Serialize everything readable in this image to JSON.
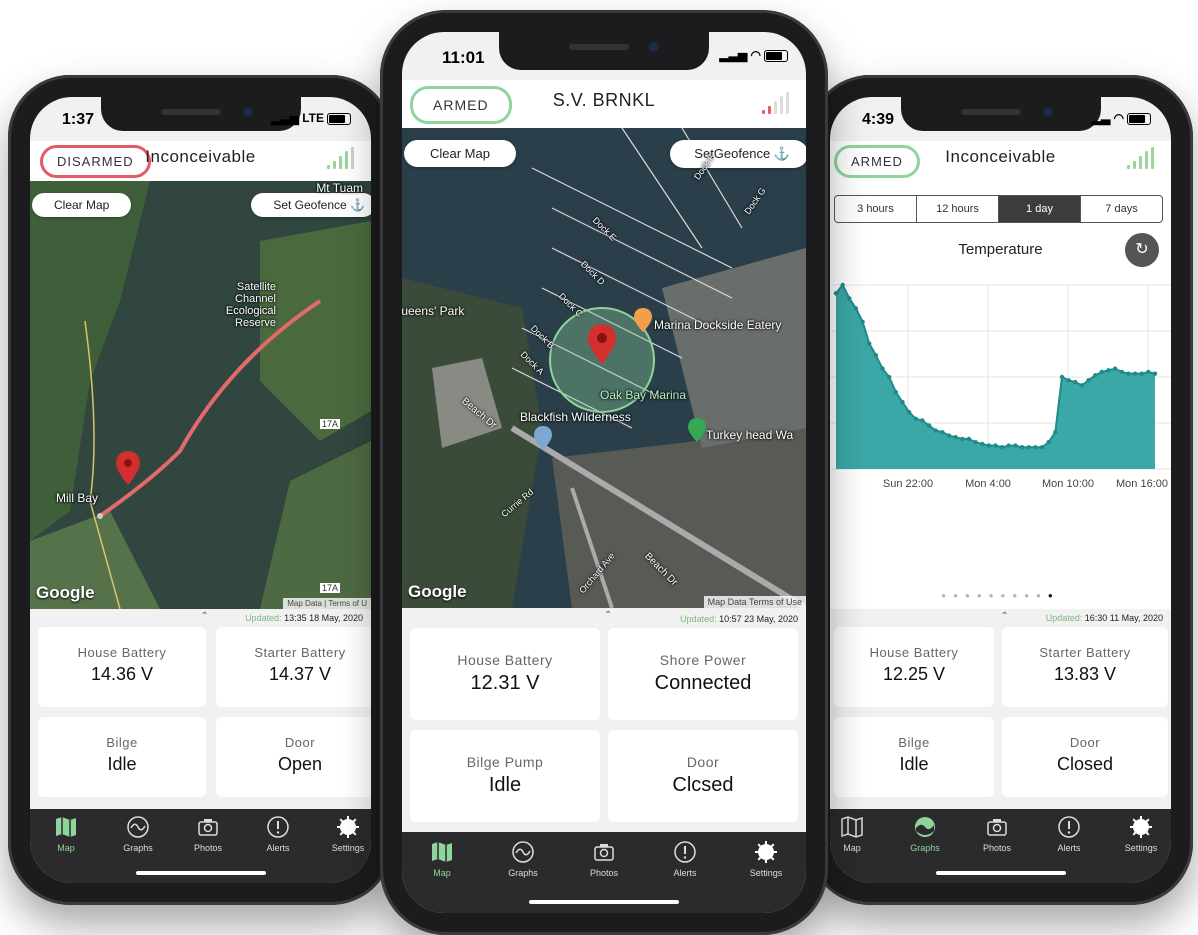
{
  "left_phone": {
    "time": "1:37",
    "network": "LTE",
    "arm_status": "DISARMED",
    "vessel_name": "Inconceivable",
    "map": {
      "clear_button": "Clear Map",
      "geofence_button": "Set Geofence",
      "labels": [
        "Mt Tuam",
        "Satellite Channel Ecological Reserve",
        "Mill Bay",
        "17A",
        "17A"
      ],
      "google": "Google",
      "map_data": "Map Data | Terms of U"
    },
    "updated_label": "Updated:",
    "updated_value": "13:35 18 May, 2020",
    "cards": [
      {
        "label": "House Battery",
        "value": "14.36 V"
      },
      {
        "label": "Starter Battery",
        "value": "14.37 V"
      },
      {
        "label": "Bilge",
        "value": "Idle"
      },
      {
        "label": "Door",
        "value": "Open"
      }
    ]
  },
  "center_phone": {
    "time": "11:01",
    "arm_status": "ARMED",
    "vessel_name": "S.V. BRNKL",
    "map": {
      "clear_button": "Clear Map",
      "geofence_button": "SetGeofence",
      "labels": [
        "Queens' Park",
        "Marina Dockside Eatery",
        "Oak Bay Marina",
        "Blackfish Wilderness",
        "Turkey head Wa",
        "Beach Dr",
        "Currie Rd",
        "Orchard Ave",
        "Beach Dr",
        "Dock E",
        "Dock D",
        "Dock C",
        "Dock B",
        "Dock A",
        "Dock F",
        "Dock G"
      ],
      "google": "Google",
      "map_data": "Map Data   Terms of Use"
    },
    "updated_label": "Updated:",
    "updated_value": "10:57 23 May, 2020",
    "cards": [
      {
        "label": "House Battery",
        "value": "12.31 V"
      },
      {
        "label": "Shore Power",
        "value": "Connected"
      },
      {
        "label": "Bilge Pump",
        "value": "Idle"
      },
      {
        "label": "Door",
        "value": "Clcsed"
      }
    ]
  },
  "right_phone": {
    "time": "4:39",
    "arm_status": "ARMED",
    "vessel_name": "Inconceivable",
    "ranges": [
      "3 hours",
      "12 hours",
      "1 day",
      "7 days"
    ],
    "selected_range": "1 day",
    "graph_title": "Temperature",
    "updated_label": "Updated:",
    "updated_value": "16:30 11 May, 2020",
    "cards": [
      {
        "label": "House Battery",
        "value": "12.25 V"
      },
      {
        "label": "Starter Battery",
        "value": "13.83 V"
      },
      {
        "label": "Bilge",
        "value": "Idle"
      },
      {
        "label": "Door",
        "value": "Closed"
      }
    ],
    "page_dots": 10,
    "active_dot": 10
  },
  "tabs": [
    "Map",
    "Graphs",
    "Photos",
    "Alerts",
    "Settings"
  ],
  "colors": {
    "accent": "#8fd49b",
    "disarmed": "#e35b64",
    "chart_fill": "#3aa8a6",
    "chart_line": "#1f8b8a"
  },
  "chart_data": {
    "type": "area",
    "title": "Temperature",
    "xlabel": "",
    "ylabel": "",
    "x_ticks": [
      "Sun 22:00",
      "Mon 4:00",
      "Mon 10:00",
      "Mon 16:00"
    ],
    "values": [
      19.5,
      20.0,
      19.2,
      18.6,
      17.8,
      16.5,
      15.8,
      15.0,
      14.5,
      13.6,
      13.0,
      12.4,
      12.0,
      11.9,
      11.6,
      11.3,
      11.2,
      11.0,
      10.9,
      10.8,
      10.8,
      10.6,
      10.5,
      10.4,
      10.4,
      10.3,
      10.4,
      10.4,
      10.3,
      10.3,
      10.3,
      10.3,
      10.6,
      11.2,
      14.5,
      14.3,
      14.2,
      14.0,
      14.3,
      14.6,
      14.8,
      14.9,
      15.0,
      14.8,
      14.7,
      14.7,
      14.7,
      14.8,
      14.7
    ],
    "ylim": [
      9,
      20
    ],
    "grid": true
  }
}
